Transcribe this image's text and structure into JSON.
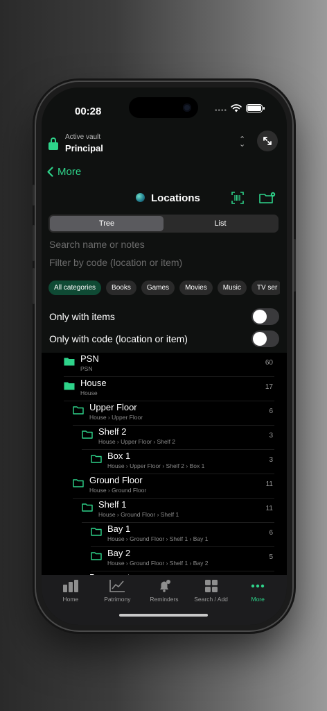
{
  "status": {
    "time": "00:28"
  },
  "vault": {
    "label": "Active vault",
    "name": "Principal"
  },
  "nav": {
    "back_label": "More"
  },
  "page": {
    "title": "Locations"
  },
  "segment": {
    "items": [
      "Tree",
      "List"
    ],
    "active": 0
  },
  "search": {
    "placeholder": "Search name or notes",
    "filter_placeholder": "Filter by code (location or item)"
  },
  "categories": [
    "All categories",
    "Books",
    "Games",
    "Movies",
    "Music",
    "TV ser"
  ],
  "toggles": [
    {
      "label": "Only with items",
      "on": false
    },
    {
      "label": "Only with code (location or item)",
      "on": false
    }
  ],
  "tree": [
    {
      "name": "PSN",
      "path": "PSN",
      "count": "60",
      "depth": 0
    },
    {
      "name": "House",
      "path": "House",
      "count": "17",
      "depth": 0
    },
    {
      "name": "Upper Floor",
      "path": "House › Upper Floor",
      "count": "6",
      "depth": 1
    },
    {
      "name": "Shelf 2",
      "path": "House › Upper Floor › Shelf 2",
      "count": "3",
      "depth": 2
    },
    {
      "name": "Box 1",
      "path": "House › Upper Floor › Shelf 2 › Box 1",
      "count": "3",
      "depth": 3
    },
    {
      "name": "Ground Floor",
      "path": "House › Ground Floor",
      "count": "11",
      "depth": 1
    },
    {
      "name": "Shelf 1",
      "path": "House › Ground Floor › Shelf 1",
      "count": "11",
      "depth": 2
    },
    {
      "name": "Bay 1",
      "path": "House › Ground Floor › Shelf 1 › Bay 1",
      "count": "6",
      "depth": 3
    },
    {
      "name": "Bay 2",
      "path": "House › Ground Floor › Shelf 1 › Bay 2",
      "count": "5",
      "depth": 3
    },
    {
      "name": "Basement",
      "path": "",
      "count": "",
      "depth": 1
    }
  ],
  "tabs": [
    {
      "label": "Home",
      "icon": "chart-bars-icon"
    },
    {
      "label": "Patrimony",
      "icon": "trend-chart-icon"
    },
    {
      "label": "Reminders",
      "icon": "bell-icon"
    },
    {
      "label": "Search / Add",
      "icon": "grid-icon"
    },
    {
      "label": "More",
      "icon": "ellipsis-icon"
    }
  ],
  "colors": {
    "accent": "#2ed38a",
    "background": "#0f1110",
    "list_bg": "#000000"
  }
}
